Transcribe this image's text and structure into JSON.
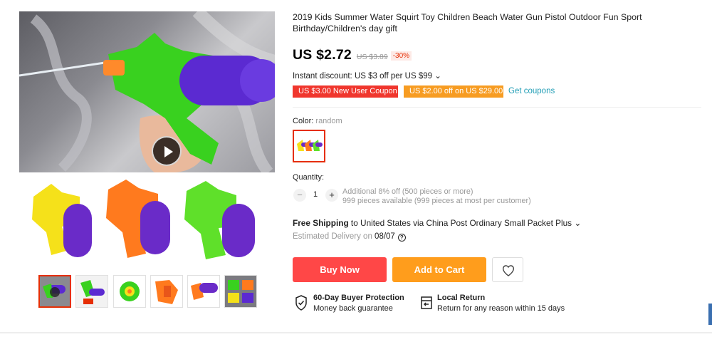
{
  "product": {
    "title": "2019 Kids Summer Water Squirt Toy Children Beach Water Gun Pistol Outdoor Fun Sport Birthday/Children's day gift"
  },
  "price": {
    "current": "US $2.72",
    "original": "US $3.89",
    "discount": "-30%"
  },
  "instant_discount": "Instant discount: US $3 off per US $99 ⌄",
  "coupons": {
    "new_user": "US $3.00 New User Coupon",
    "store": "US $2.00 off on US $29.00",
    "get_label": "Get coupons"
  },
  "color": {
    "label": "Color:",
    "value": "random"
  },
  "quantity": {
    "label": "Quantity:",
    "minus": "−",
    "plus": "+",
    "value": "1",
    "note_line1": "Additional 8% off (500 pieces or more)",
    "note_line2": "999 pieces available (999 pieces at most per customer)"
  },
  "shipping": {
    "free_label": "Free Shipping",
    "rest": " to United States via China Post Ordinary Small Packet Plus ⌄",
    "delivery_prefix": "Estimated Delivery on ",
    "delivery_date": "08/07",
    "help": "?"
  },
  "actions": {
    "buy_now": "Buy Now",
    "add_to_cart": "Add to Cart"
  },
  "guarantees": [
    {
      "title": "60-Day Buyer Protection",
      "subtitle": "Money back guarantee"
    },
    {
      "title": "Local Return",
      "subtitle": "Return for any reason within 15 days"
    }
  ],
  "colors": {
    "accent_red": "#ff4747",
    "accent_orange": "#ff9d1c",
    "link": "#1f9db5",
    "selected_border": "#e62e04"
  },
  "icons": {
    "play": "play-icon",
    "wishlist": "heart-icon",
    "protection": "shield-check-icon",
    "return": "return-box-icon"
  }
}
